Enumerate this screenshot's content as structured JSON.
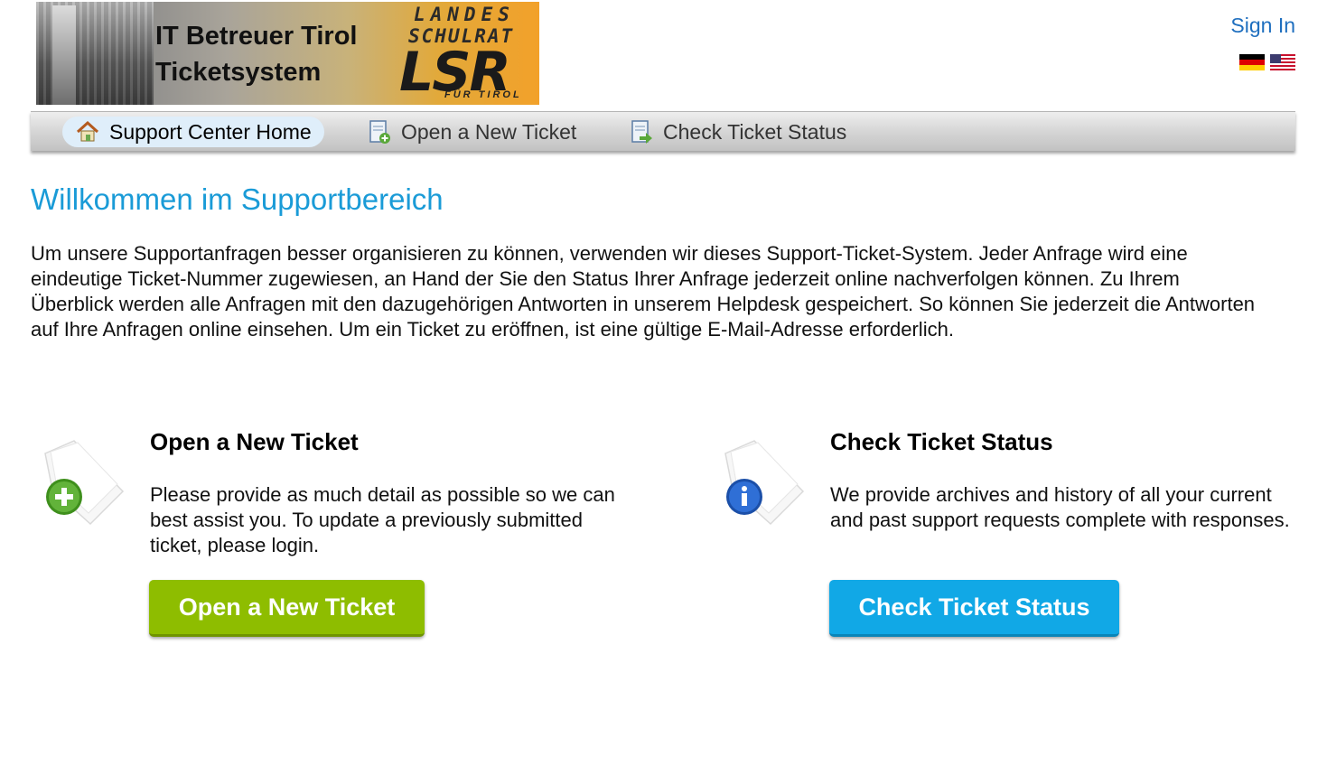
{
  "header": {
    "logo": {
      "line1": "IT Betreuer Tirol",
      "line2": "Ticketsystem",
      "brand_line1": "LANDES",
      "brand_line2": "SCHULRAT",
      "brand_mark": "LSR",
      "brand_sub": "FÜR TIROL"
    },
    "sign_in": "Sign In",
    "flags": [
      "german-flag-icon",
      "us-flag-icon"
    ]
  },
  "nav": {
    "items": [
      {
        "label": "Support Center Home",
        "icon": "home-icon",
        "active": true
      },
      {
        "label": "Open a New Ticket",
        "icon": "new-ticket-icon",
        "active": false
      },
      {
        "label": "Check Ticket Status",
        "icon": "ticket-status-icon",
        "active": false
      }
    ]
  },
  "main": {
    "title": "Willkommen im Supportbereich",
    "intro": "Um unsere Supportanfragen besser organisieren zu können, verwenden wir dieses Support-Ticket-System. Jeder Anfrage wird eine eindeutige Ticket-Nummer zugewiesen, an Hand der Sie den Status Ihrer Anfrage jederzeit online nachverfolgen können. Zu Ihrem Überblick werden alle Anfragen mit den dazugehörigen Antworten in unserem Helpdesk gespeichert. So können Sie jederzeit die Antworten auf Ihre Anfragen online einsehen. Um ein Ticket zu eröffnen, ist eine gültige E-Mail-Adresse erforderlich.",
    "open_block": {
      "title": "Open a New Ticket",
      "text": "Please provide as much detail as possible so we can best assist you. To update a previously submitted ticket, please login.",
      "button": "Open a New Ticket",
      "icon": "new-ticket-icon"
    },
    "check_block": {
      "title": "Check Ticket Status",
      "text": "We provide archives and history of all your current and past support requests complete with responses.",
      "button": "Check Ticket Status",
      "icon": "info-ticket-icon"
    }
  },
  "colors": {
    "accent": "#1a9bd7",
    "link": "#1f6fbf",
    "open_button": "#8ebd00",
    "check_button": "#11a8e6"
  }
}
